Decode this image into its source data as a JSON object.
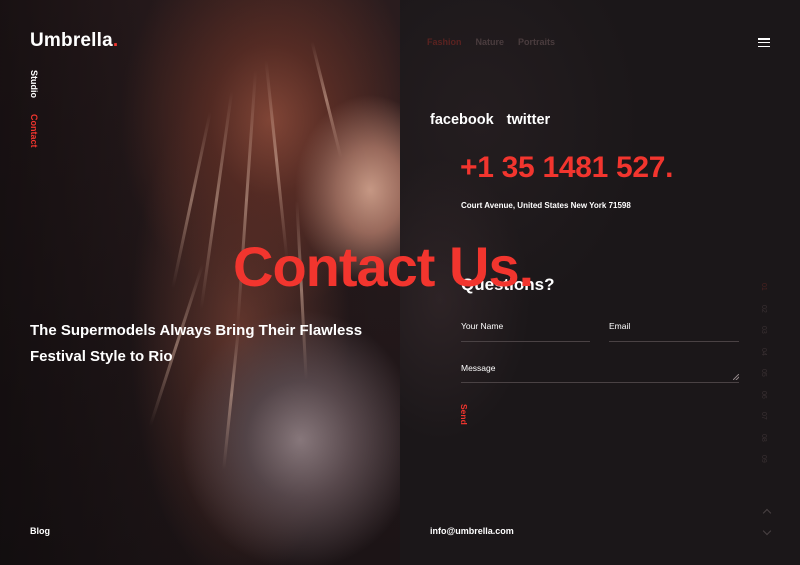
{
  "brand": {
    "name": "Umbrella",
    "dot": ".",
    "accent": "#f2352e"
  },
  "side_nav": [
    "Studio",
    "Contact"
  ],
  "top_nav": [
    "Fashion",
    "Nature",
    "Portraits"
  ],
  "hero": {
    "headline_line1": "The Supermodels Always Bring Their Flawless",
    "headline_line2": "Festival Style to Rio",
    "big_title": "Contact Us."
  },
  "contact": {
    "social": [
      "facebook",
      "twitter"
    ],
    "phone": "+1 35 1481 527.",
    "address": "Court Avenue, United States New York 71598",
    "questions": "Questions?",
    "fields": {
      "name": "Your Name",
      "email": "Email",
      "message": "Message"
    },
    "send": "Send"
  },
  "pager": [
    "01",
    "02",
    "03",
    "04",
    "05",
    "06",
    "07",
    "08",
    "09"
  ],
  "footer": {
    "blog": "Blog",
    "email": "info@umbrella.com"
  },
  "icons": {
    "menu": "hamburger-icon",
    "prev": "chevron-up-icon",
    "next": "chevron-down-icon"
  }
}
